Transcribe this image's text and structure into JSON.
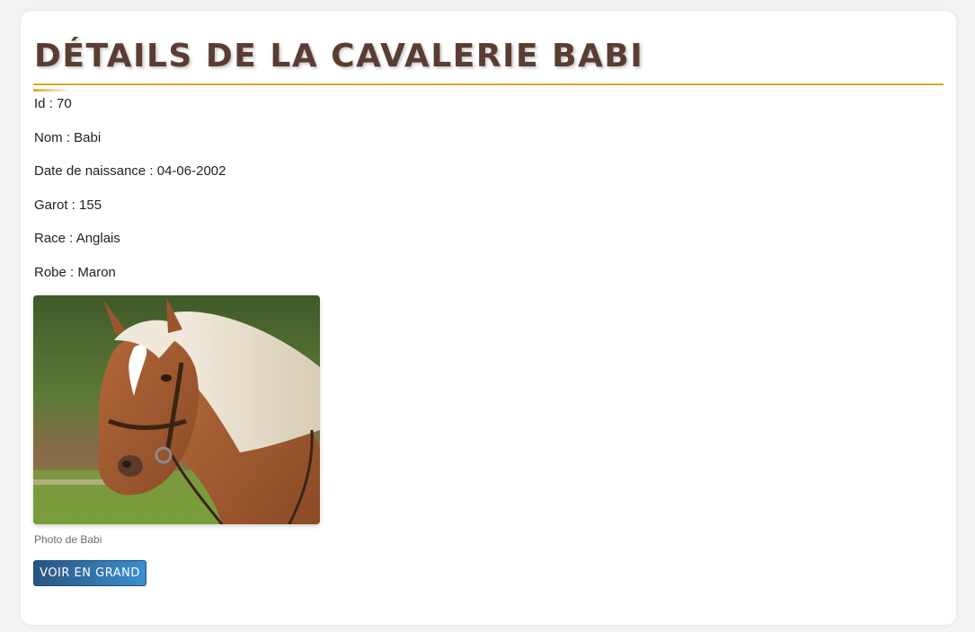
{
  "page": {
    "title": "DÉTAILS DE LA CAVALERIE BABI"
  },
  "details": [
    {
      "text": "Id : 70"
    },
    {
      "text": "Nom : Babi"
    },
    {
      "text": "Date de naissance : 04-06-2002"
    },
    {
      "text": "Garot : 155"
    },
    {
      "text": "Race : Anglais"
    },
    {
      "text": "Robe : Maron"
    }
  ],
  "photo": {
    "caption": "Photo de Babi"
  },
  "actions": {
    "view_large_label": "VOIR EN GRAND"
  },
  "colors": {
    "title": "#5a3d32",
    "accent": "#d7a82a",
    "button_start": "#2a5580",
    "button_end": "#3b8fd0"
  }
}
